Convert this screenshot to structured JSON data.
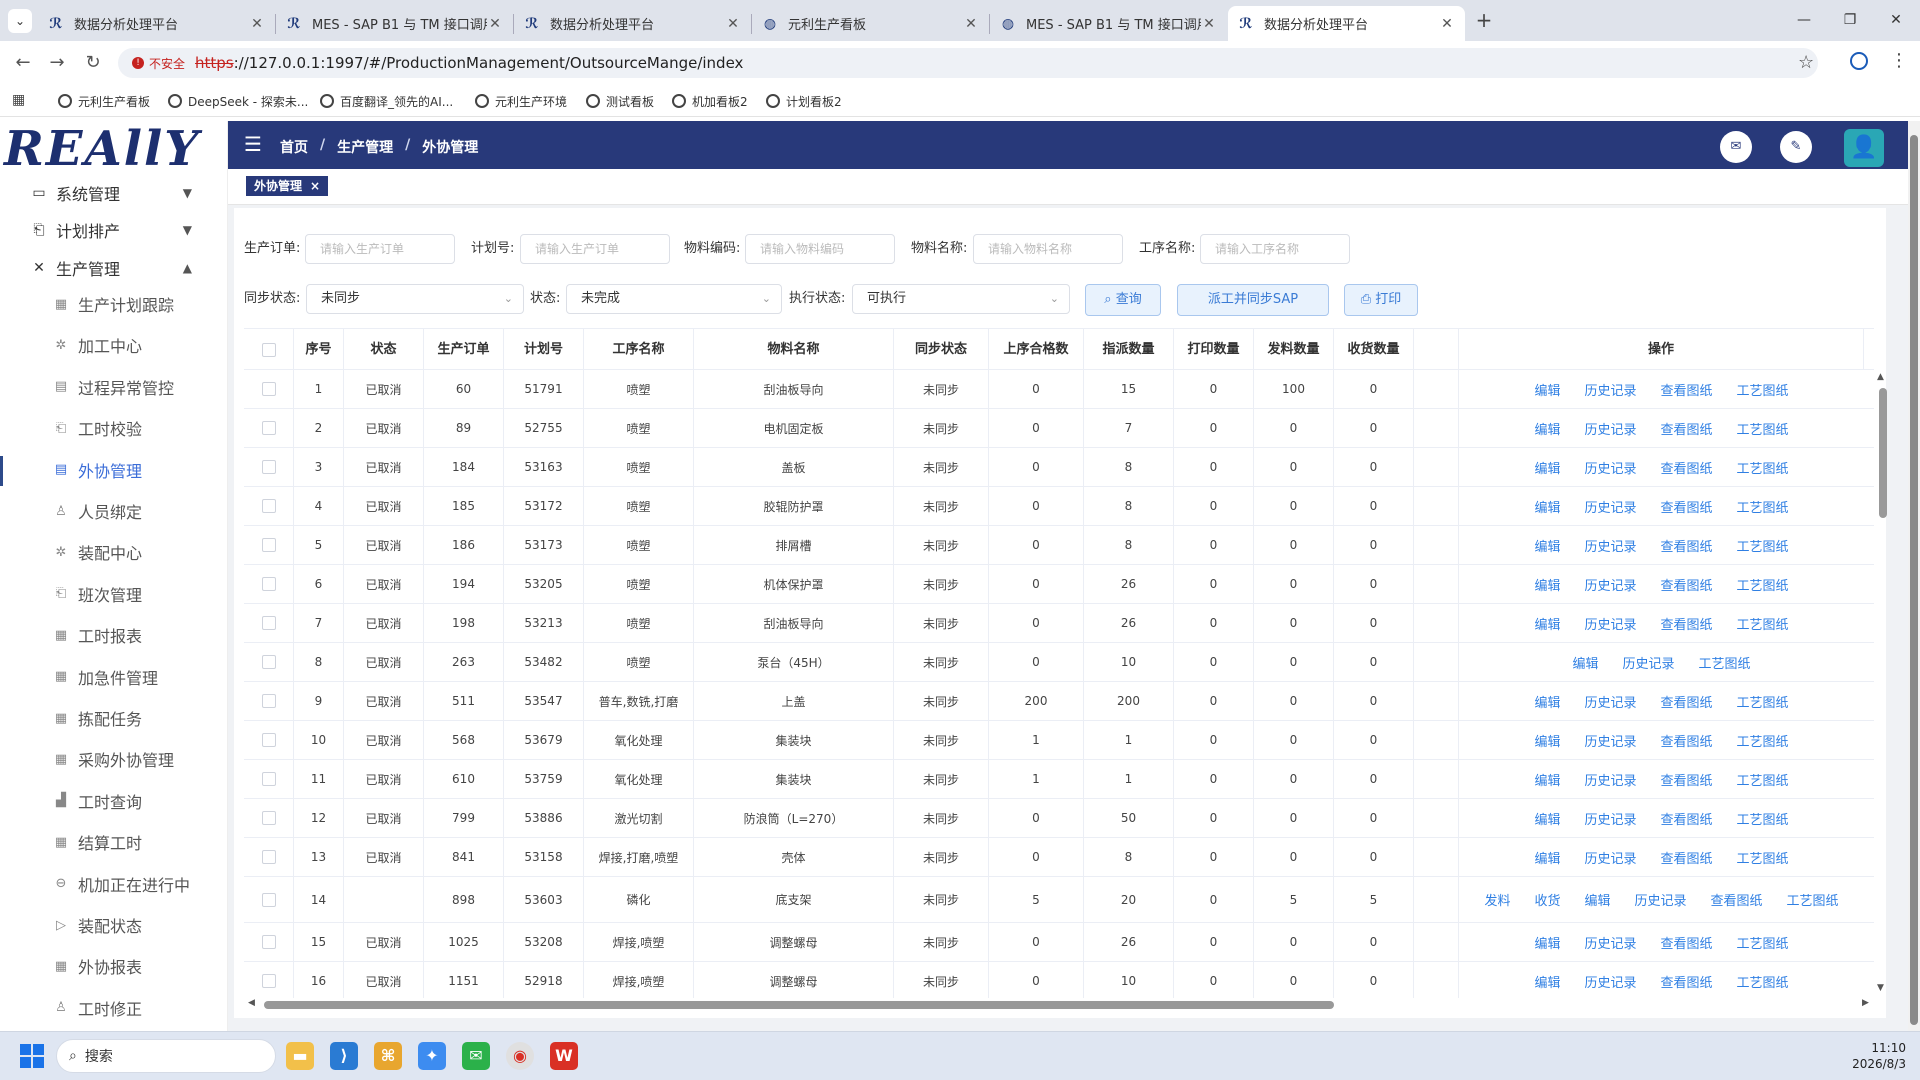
{
  "browser": {
    "tabs": [
      {
        "title": "数据分析处理平台",
        "active": false
      },
      {
        "title": "MES - SAP B1 与 TM 接口调用",
        "active": false
      },
      {
        "title": "数据分析处理平台",
        "active": false
      },
      {
        "title": "元利生产看板",
        "active": false
      },
      {
        "title": "MES - SAP B1 与 TM 接口调用",
        "active": false
      },
      {
        "title": "数据分析处理平台",
        "active": true
      }
    ],
    "insecure_label": "不安全",
    "url_scheme": "https",
    "url_rest": "://127.0.0.1:1997/#/ProductionManagement/OutsourceMange/index",
    "bookmarks": [
      "元利生产看板",
      "DeepSeek - 探索未...",
      "百度翻译_领先的AI...",
      "元利生产环境",
      "测试看板",
      "机加看板2",
      "计划看板2"
    ]
  },
  "sidebar": {
    "logo_text": "REAllY",
    "groups": [
      {
        "label": "系统管理",
        "icon": "monitor-icon"
      },
      {
        "label": "计划排产",
        "icon": "clipboard-icon"
      },
      {
        "label": "生产管理",
        "icon": "tools-icon"
      }
    ],
    "items": [
      {
        "label": "生产计划跟踪",
        "icon": "grid-icon"
      },
      {
        "label": "加工中心",
        "icon": "gear-icon"
      },
      {
        "label": "过程异常管控",
        "icon": "document-icon"
      },
      {
        "label": "工时校验",
        "icon": "clipboard-icon"
      },
      {
        "label": "外协管理",
        "icon": "document-icon"
      },
      {
        "label": "人员绑定",
        "icon": "person-icon"
      },
      {
        "label": "装配中心",
        "icon": "gear-icon"
      },
      {
        "label": "班次管理",
        "icon": "clipboard-icon"
      },
      {
        "label": "工时报表",
        "icon": "grid-icon"
      },
      {
        "label": "加急件管理",
        "icon": "grid-icon"
      },
      {
        "label": "拣配任务",
        "icon": "grid-icon"
      },
      {
        "label": "采购外协管理",
        "icon": "grid-icon"
      },
      {
        "label": "工时查询",
        "icon": "chart-icon"
      },
      {
        "label": "结算工时",
        "icon": "grid-icon"
      },
      {
        "label": "机加正在进行中",
        "icon": "circle-icon"
      },
      {
        "label": "装配状态",
        "icon": "play-icon"
      },
      {
        "label": "外协报表",
        "icon": "grid-icon"
      },
      {
        "label": "工时修正",
        "icon": "person-icon"
      }
    ]
  },
  "header": {
    "breadcrumb": [
      "首页",
      "生产管理",
      "外协管理"
    ],
    "tag_label": "外协管理"
  },
  "filters": {
    "order_label": "生产订单:",
    "order_placeholder": "请输入生产订单",
    "plan_label": "计划号:",
    "plan_placeholder": "请输入生产订单",
    "material_code_label": "物料编码:",
    "material_code_placeholder": "请输入物料编码",
    "material_name_label": "物料名称:",
    "material_name_placeholder": "请输入物料名称",
    "process_label": "工序名称:",
    "process_placeholder": "请输入工序名称",
    "sync_label": "同步状态:",
    "sync_value": "未同步",
    "status_label": "状态:",
    "status_value": "未完成",
    "exec_label": "执行状态:",
    "exec_value": "可执行",
    "query_button": "查询",
    "dispatch_button": "派工并同步SAP",
    "print_button": "打印"
  },
  "table": {
    "columns": [
      "序号",
      "状态",
      "生产订单",
      "计划号",
      "工序名称",
      "物料名称",
      "同步状态",
      "上序合格数",
      "指派数量",
      "打印数量",
      "发料数量",
      "收货数量",
      "",
      "操作"
    ],
    "rows": [
      {
        "no": "1",
        "status": "已取消",
        "order": "60",
        "plan": "51791",
        "process": "喷塑",
        "material": "刮油板导向",
        "sync": "未同步",
        "prev_ok": "0",
        "assigned": "15",
        "printed": "0",
        "issued": "100",
        "received": "0",
        "ops": [
          "编辑",
          "历史记录",
          "查看图纸",
          "工艺图纸"
        ]
      },
      {
        "no": "2",
        "status": "已取消",
        "order": "89",
        "plan": "52755",
        "process": "喷塑",
        "material": "电机固定板",
        "sync": "未同步",
        "prev_ok": "0",
        "assigned": "7",
        "printed": "0",
        "issued": "0",
        "received": "0",
        "ops": [
          "编辑",
          "历史记录",
          "查看图纸",
          "工艺图纸"
        ]
      },
      {
        "no": "3",
        "status": "已取消",
        "order": "184",
        "plan": "53163",
        "process": "喷塑",
        "material": "盖板",
        "sync": "未同步",
        "prev_ok": "0",
        "assigned": "8",
        "printed": "0",
        "issued": "0",
        "received": "0",
        "ops": [
          "编辑",
          "历史记录",
          "查看图纸",
          "工艺图纸"
        ]
      },
      {
        "no": "4",
        "status": "已取消",
        "order": "185",
        "plan": "53172",
        "process": "喷塑",
        "material": "胶辊防护罩",
        "sync": "未同步",
        "prev_ok": "0",
        "assigned": "8",
        "printed": "0",
        "issued": "0",
        "received": "0",
        "ops": [
          "编辑",
          "历史记录",
          "查看图纸",
          "工艺图纸"
        ]
      },
      {
        "no": "5",
        "status": "已取消",
        "order": "186",
        "plan": "53173",
        "process": "喷塑",
        "material": "排屑槽",
        "sync": "未同步",
        "prev_ok": "0",
        "assigned": "8",
        "printed": "0",
        "issued": "0",
        "received": "0",
        "ops": [
          "编辑",
          "历史记录",
          "查看图纸",
          "工艺图纸"
        ]
      },
      {
        "no": "6",
        "status": "已取消",
        "order": "194",
        "plan": "53205",
        "process": "喷塑",
        "material": "机体保护罩",
        "sync": "未同步",
        "prev_ok": "0",
        "assigned": "26",
        "printed": "0",
        "issued": "0",
        "received": "0",
        "ops": [
          "编辑",
          "历史记录",
          "查看图纸",
          "工艺图纸"
        ]
      },
      {
        "no": "7",
        "status": "已取消",
        "order": "198",
        "plan": "53213",
        "process": "喷塑",
        "material": "刮油板导向",
        "sync": "未同步",
        "prev_ok": "0",
        "assigned": "26",
        "printed": "0",
        "issued": "0",
        "received": "0",
        "ops": [
          "编辑",
          "历史记录",
          "查看图纸",
          "工艺图纸"
        ]
      },
      {
        "no": "8",
        "status": "已取消",
        "order": "263",
        "plan": "53482",
        "process": "喷塑",
        "material": "泵台（45H）",
        "sync": "未同步",
        "prev_ok": "0",
        "assigned": "10",
        "printed": "0",
        "issued": "0",
        "received": "0",
        "ops": [
          "编辑",
          "历史记录",
          "工艺图纸"
        ]
      },
      {
        "no": "9",
        "status": "已取消",
        "order": "511",
        "plan": "53547",
        "process": "普车,数铣,打磨",
        "material": "上盖",
        "sync": "未同步",
        "prev_ok": "200",
        "assigned": "200",
        "printed": "0",
        "issued": "0",
        "received": "0",
        "ops": [
          "编辑",
          "历史记录",
          "查看图纸",
          "工艺图纸"
        ]
      },
      {
        "no": "10",
        "status": "已取消",
        "order": "568",
        "plan": "53679",
        "process": "氧化处理",
        "material": "集装块",
        "sync": "未同步",
        "prev_ok": "1",
        "assigned": "1",
        "printed": "0",
        "issued": "0",
        "received": "0",
        "ops": [
          "编辑",
          "历史记录",
          "查看图纸",
          "工艺图纸"
        ]
      },
      {
        "no": "11",
        "status": "已取消",
        "order": "610",
        "plan": "53759",
        "process": "氧化处理",
        "material": "集装块",
        "sync": "未同步",
        "prev_ok": "1",
        "assigned": "1",
        "printed": "0",
        "issued": "0",
        "received": "0",
        "ops": [
          "编辑",
          "历史记录",
          "查看图纸",
          "工艺图纸"
        ]
      },
      {
        "no": "12",
        "status": "已取消",
        "order": "799",
        "plan": "53886",
        "process": "激光切割",
        "material": "防浪筒（L=270）",
        "sync": "未同步",
        "prev_ok": "0",
        "assigned": "50",
        "printed": "0",
        "issued": "0",
        "received": "0",
        "ops": [
          "编辑",
          "历史记录",
          "查看图纸",
          "工艺图纸"
        ]
      },
      {
        "no": "13",
        "status": "已取消",
        "order": "841",
        "plan": "53158",
        "process": "焊接,打磨,喷塑",
        "material": "壳体",
        "sync": "未同步",
        "prev_ok": "0",
        "assigned": "8",
        "printed": "0",
        "issued": "0",
        "received": "0",
        "ops": [
          "编辑",
          "历史记录",
          "查看图纸",
          "工艺图纸"
        ]
      },
      {
        "no": "14",
        "status": "",
        "order": "898",
        "plan": "53603",
        "process": "磷化",
        "material": "底支架",
        "sync": "未同步",
        "prev_ok": "5",
        "assigned": "20",
        "printed": "0",
        "issued": "5",
        "received": "5",
        "ops": [
          "发料",
          "收货",
          "编辑",
          "历史记录",
          "查看图纸",
          "工艺图纸"
        ]
      },
      {
        "no": "15",
        "status": "已取消",
        "order": "1025",
        "plan": "53208",
        "process": "焊接,喷塑",
        "material": "调整螺母",
        "sync": "未同步",
        "prev_ok": "0",
        "assigned": "26",
        "printed": "0",
        "issued": "0",
        "received": "0",
        "ops": [
          "编辑",
          "历史记录",
          "查看图纸",
          "工艺图纸"
        ]
      },
      {
        "no": "16",
        "status": "已取消",
        "order": "1151",
        "plan": "52918",
        "process": "焊接,喷塑",
        "material": "调整螺母",
        "sync": "未同步",
        "prev_ok": "0",
        "assigned": "10",
        "printed": "0",
        "issued": "0",
        "received": "0",
        "ops": [
          "编辑",
          "历史记录",
          "查看图纸",
          "工艺图纸"
        ]
      }
    ]
  },
  "taskbar": {
    "search_label": "搜索",
    "time": "11:10",
    "date": "2026/8/3"
  },
  "colors": {
    "header": "#28397a",
    "link": "#2f7fe3",
    "active_menu": "#3b6dd8"
  }
}
